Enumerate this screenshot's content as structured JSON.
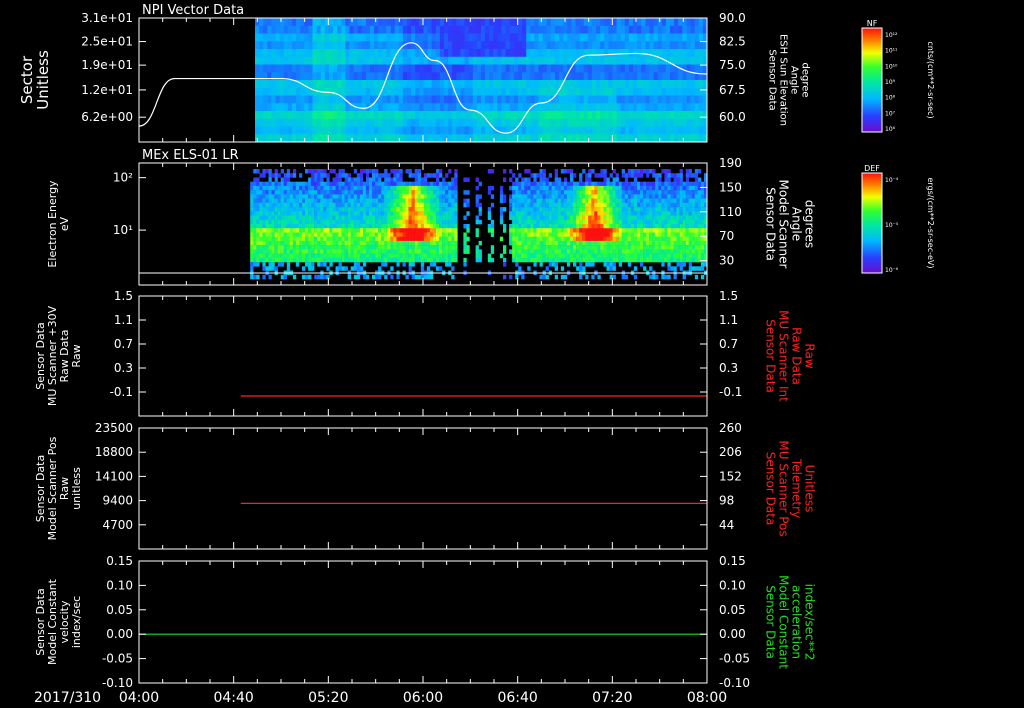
{
  "date_label": "2017/310",
  "time_ticks": [
    "04:00",
    "04:40",
    "05:20",
    "06:00",
    "06:40",
    "07:20",
    "08:00"
  ],
  "colors": {
    "background": "#000000",
    "axis": "#ffffff",
    "red_trace": "#ff2020",
    "green_trace": "#22dd22"
  },
  "panels": [
    {
      "title": "NPI Vector Data",
      "left_label": [
        "Sector",
        "Unitless"
      ],
      "left_ticks": [
        "3.1e+01",
        "2.5e+01",
        "1.9e+01",
        "1.2e+01",
        "6.2e+00"
      ],
      "right_label": [
        "Sensor Data",
        "ESH Sun Elevation",
        "Angle",
        "degree"
      ],
      "right_label_color": "#ffffff",
      "right_ticks": [
        "90.0",
        "82.5",
        "75.0",
        "67.5",
        "60.0"
      ],
      "colorbar": {
        "label": "NF",
        "unit": "cnts/(cm**2-sr-sec)",
        "ticks": [
          "10¹²",
          "10¹¹",
          "10¹⁰",
          "10⁹",
          "10⁸",
          "10⁷",
          "10⁶"
        ]
      }
    },
    {
      "title": "MEx ELS-01 LR",
      "left_label": [
        "Electron Energy",
        "eV"
      ],
      "left_ticks": [
        "10²",
        "10¹"
      ],
      "right_label": [
        "Sensor Data",
        "Model Scanner",
        "Angle",
        "degrees"
      ],
      "right_label_color": "#ffffff",
      "right_ticks": [
        "190",
        "150",
        "110",
        "70",
        "30"
      ],
      "colorbar": {
        "label": "DEF",
        "unit": "ergs/(cm**2-sr-sec-eV)",
        "ticks": [
          "10⁻⁴",
          "10⁻⁵",
          "10⁻⁶"
        ]
      }
    },
    {
      "left_label": [
        "Sensor Data",
        "MU Scanner +30V",
        "Raw Data",
        "Raw"
      ],
      "left_ticks": [
        "1.5",
        "1.1",
        "0.7",
        "0.3",
        "-0.1"
      ],
      "right_label": [
        "Sensor Data",
        "MU Scanner Int",
        "Raw Data",
        "Raw"
      ],
      "right_label_color": "#ff2020",
      "right_ticks": [
        "1.5",
        "1.1",
        "0.7",
        "0.3",
        "-0.1"
      ]
    },
    {
      "left_label": [
        "Sensor Data",
        "Model Scanner Pos",
        "Raw",
        "unitless"
      ],
      "left_ticks": [
        "23500",
        "18800",
        "14100",
        "9400",
        "4700"
      ],
      "right_label": [
        "Sensor Data",
        "MU Scanner Pos",
        "Telemetry",
        "Unitless"
      ],
      "right_label_color": "#ff2020",
      "right_ticks": [
        "260",
        "206",
        "152",
        "98",
        "44"
      ]
    },
    {
      "left_label": [
        "Sensor Data",
        "Model Constant",
        "velocity",
        "index/sec"
      ],
      "left_ticks": [
        "0.15",
        "0.10",
        "0.05",
        "0.00",
        "-0.05",
        "-0.10"
      ],
      "right_label": [
        "Sensor Data",
        "Model Constant",
        "acceleration",
        "index/sec**2"
      ],
      "right_label_color": "#22dd22",
      "right_ticks": [
        "0.15",
        "0.10",
        "0.05",
        "0.00",
        "-0.05",
        "-0.10"
      ]
    }
  ],
  "chart_data": [
    {
      "type": "heatmap",
      "title": "NPI Vector Data",
      "x_range": [
        "04:00",
        "08:00"
      ],
      "ylabel": "Sector Unitless",
      "ylim": [
        0,
        31
      ],
      "overlay_line": {
        "name": "ESH Sun Elevation Angle",
        "axis": "right",
        "ylim": [
          55.0,
          90.0
        ],
        "x": [
          "04:00",
          "04:15",
          "05:00",
          "05:20",
          "05:35",
          "05:55",
          "06:05",
          "06:20",
          "06:35",
          "06:50",
          "07:10",
          "07:30",
          "08:00"
        ],
        "y": [
          59.5,
          72.9,
          72.9,
          69.0,
          64.5,
          83.0,
          78.0,
          64.0,
          57.5,
          66.0,
          79.5,
          80.0,
          74.2
        ]
      },
      "data_start": "04:49"
    },
    {
      "type": "heatmap",
      "title": "MEx ELS-01 LR",
      "x_range": [
        "04:00",
        "08:00"
      ],
      "ylabel": "Electron Energy eV",
      "y_scale": "log",
      "overlay_line": {
        "name": "Model Scanner Angle",
        "axis": "right",
        "ylim": [
          0,
          190
        ],
        "x": [
          "04:00",
          "08:00"
        ],
        "y": [
          0,
          0
        ]
      },
      "data_start": "04:47",
      "hot_spots": [
        "05:55",
        "07:12"
      ]
    },
    {
      "type": "line",
      "ylim": [
        -0.3,
        1.5
      ],
      "series": [
        {
          "x": [
            "04:43",
            "08:00"
          ],
          "y": [
            0.0,
            0.0
          ]
        }
      ]
    },
    {
      "type": "line",
      "ylim": [
        0,
        23500
      ],
      "right_ylim": [
        0,
        260
      ],
      "series": [
        {
          "x": [
            "04:43",
            "08:00"
          ],
          "y": [
            98,
            98
          ]
        }
      ]
    },
    {
      "type": "line",
      "ylim": [
        -0.1,
        0.15
      ],
      "series": [
        {
          "x": [
            "04:00",
            "08:00"
          ],
          "y": [
            0.0,
            0.0
          ]
        }
      ]
    }
  ]
}
